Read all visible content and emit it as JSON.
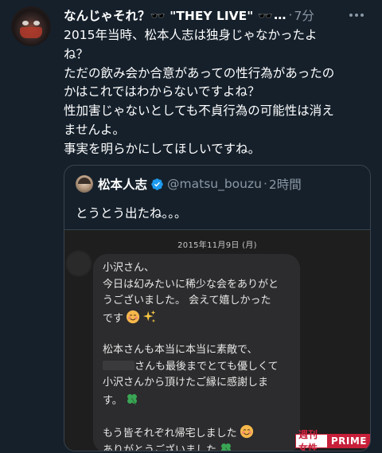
{
  "tweet": {
    "display_name": "なんじゃそれ？🕶️ \"THEY LIVE\" 🕶️",
    "name_ellipsis": "…",
    "separator": "·",
    "time": "7分",
    "text_lines": [
      "2015年当時、松本人志は独身じゃなかったよ",
      "ね？",
      "ただの飲み会か合意があっての性行為があったの",
      "かはこれではわからないですよね？",
      "性加害じゃないとしても不貞行為の可能性は消え",
      "ませんよ。",
      "事実を明らかにしてほしいですね。"
    ]
  },
  "quote": {
    "name": "松本人志",
    "handle": "@matsu_bouzu",
    "separator": "·",
    "time": "2時間",
    "text": "とうとう出たね。。。",
    "media": {
      "date": "2015年11月9日 (月)",
      "message_lines": [
        "小沢さん、",
        "今日は幻みたいに稀少な会をありがと",
        "うございました。 会えて嬉しかった",
        "です",
        "",
        "松本さんも本当に本当に素敵で、",
        "さんも最後までとても優しくて",
        "小沢さんから頂けたご縁に感謝しま",
        "す。",
        "",
        "もう皆それぞれ帰宅しました",
        "ありがとうございました"
      ],
      "watermark_left": "週刊女性",
      "watermark_right": "PRIME"
    }
  },
  "colors": {
    "background": "#15202b",
    "secondary_text": "#8b98a5",
    "verified": "#1d9bf0",
    "border": "#38444d",
    "watermark": "#c8203a"
  }
}
